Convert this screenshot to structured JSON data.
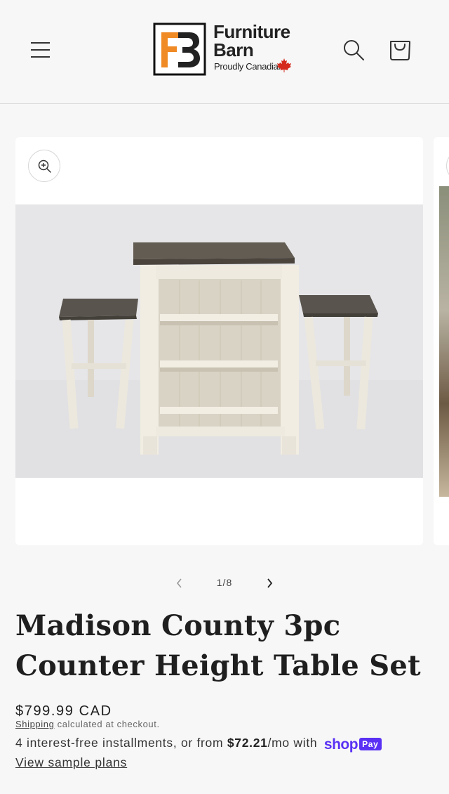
{
  "header": {
    "menu_icon": "hamburger-menu-icon",
    "logo": {
      "name_line1": "Furniture",
      "name_line2": "Barn",
      "tagline": "Proudly Canadian",
      "monogram": "FB"
    },
    "search_icon": "search-icon",
    "cart_icon": "cart-icon"
  },
  "gallery": {
    "zoom_icon": "zoom-in-icon",
    "image_alt": "Madison County 3pc Counter Height Table Set",
    "pager": {
      "prev_icon": "chevron-left-icon",
      "next_icon": "chevron-right-icon",
      "count": "1/8"
    }
  },
  "product": {
    "title": "Madison County 3pc Counter Height Table Set",
    "price": "$799.99 CAD",
    "shipping_link": "Shipping",
    "shipping_note": " calculated at checkout.",
    "installments_prefix": "4 interest-free installments, or from ",
    "installments_amount": "$72.21",
    "installments_suffix": "/mo with ",
    "shoppay_word": "shop",
    "shoppay_badge": "Pay",
    "view_plans": "View sample plans"
  },
  "colors": {
    "accent": "#5a31f4",
    "logo_orange": "#f08a24",
    "background": "#f7f7f7"
  }
}
